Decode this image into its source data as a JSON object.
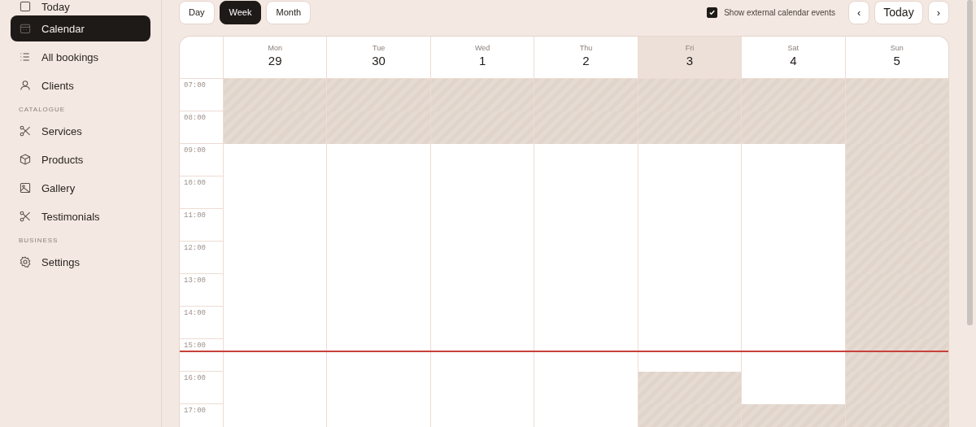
{
  "sidebar": {
    "items": [
      {
        "kind": "item",
        "label": "Today",
        "selected": false
      },
      {
        "kind": "item",
        "label": "Calendar",
        "selected": true
      },
      {
        "kind": "item",
        "label": "All bookings",
        "selected": false
      },
      {
        "kind": "item",
        "label": "Clients",
        "selected": false
      },
      {
        "kind": "section",
        "label": "CATALOGUE"
      },
      {
        "kind": "item",
        "label": "Services",
        "selected": false
      },
      {
        "kind": "item",
        "label": "Products",
        "selected": false
      },
      {
        "kind": "item",
        "label": "Gallery",
        "selected": false
      },
      {
        "kind": "item",
        "label": "Testimonials",
        "selected": false
      },
      {
        "kind": "section",
        "label": "BUSINESS"
      },
      {
        "kind": "item",
        "label": "Settings",
        "selected": false
      }
    ]
  },
  "toolbar": {
    "views": [
      {
        "label": "Day",
        "selected": false
      },
      {
        "label": "Week",
        "selected": true
      },
      {
        "label": "Month",
        "selected": false
      }
    ],
    "external_events": {
      "label": "Show external calendar events",
      "checked": true
    },
    "prev": "‹",
    "today": "Today",
    "next": "›"
  },
  "calendar": {
    "times": [
      "07:00",
      "08:00",
      "09:00",
      "10:00",
      "11:00",
      "12:00",
      "13:00",
      "14:00",
      "15:00",
      "16:00",
      "17:00"
    ],
    "days": [
      {
        "weekday": "Mon",
        "date": "29",
        "today": false,
        "slots": [
          {
            "closed": true
          },
          {
            "closed": true
          },
          {
            "closed": false
          },
          {
            "closed": false
          },
          {
            "closed": false
          },
          {
            "closed": false
          },
          {
            "closed": false
          },
          {
            "closed": false
          },
          {
            "closed": false
          },
          {
            "closed": false
          },
          {
            "closed": false
          }
        ]
      },
      {
        "weekday": "Tue",
        "date": "30",
        "today": false,
        "slots": [
          {
            "closed": true
          },
          {
            "closed": true
          },
          {
            "closed": false
          },
          {
            "closed": false
          },
          {
            "closed": false
          },
          {
            "closed": false
          },
          {
            "closed": false
          },
          {
            "closed": false
          },
          {
            "closed": false
          },
          {
            "closed": false
          },
          {
            "closed": false
          }
        ]
      },
      {
        "weekday": "Wed",
        "date": "1",
        "today": false,
        "slots": [
          {
            "closed": true
          },
          {
            "closed": true
          },
          {
            "closed": false
          },
          {
            "closed": false
          },
          {
            "closed": false
          },
          {
            "closed": false
          },
          {
            "closed": false
          },
          {
            "closed": false
          },
          {
            "closed": false
          },
          {
            "closed": false
          },
          {
            "closed": false
          }
        ]
      },
      {
        "weekday": "Thu",
        "date": "2",
        "today": false,
        "slots": [
          {
            "closed": true
          },
          {
            "closed": true
          },
          {
            "closed": false
          },
          {
            "closed": false
          },
          {
            "closed": false
          },
          {
            "closed": false
          },
          {
            "closed": false
          },
          {
            "closed": false
          },
          {
            "closed": false
          },
          {
            "closed": false
          },
          {
            "closed": false
          }
        ]
      },
      {
        "weekday": "Fri",
        "date": "3",
        "today": true,
        "slots": [
          {
            "closed": true
          },
          {
            "closed": true
          },
          {
            "closed": false
          },
          {
            "closed": false
          },
          {
            "closed": false
          },
          {
            "closed": false
          },
          {
            "closed": false
          },
          {
            "closed": false
          },
          {
            "closed": false
          },
          {
            "closed": true
          },
          {
            "closed": true
          }
        ]
      },
      {
        "weekday": "Sat",
        "date": "4",
        "today": false,
        "slots": [
          {
            "closed": true
          },
          {
            "closed": true
          },
          {
            "closed": false
          },
          {
            "closed": false
          },
          {
            "closed": false
          },
          {
            "closed": false
          },
          {
            "closed": false
          },
          {
            "closed": false
          },
          {
            "closed": false
          },
          {
            "closed": false
          },
          {
            "closed": true
          }
        ]
      },
      {
        "weekday": "Sun",
        "date": "5",
        "today": false,
        "slots": [
          {
            "closed": true
          },
          {
            "closed": true
          },
          {
            "closed": true
          },
          {
            "closed": true
          },
          {
            "closed": true
          },
          {
            "closed": true
          },
          {
            "closed": true
          },
          {
            "closed": true
          },
          {
            "closed": true
          },
          {
            "closed": true
          },
          {
            "closed": true
          }
        ]
      }
    ]
  }
}
